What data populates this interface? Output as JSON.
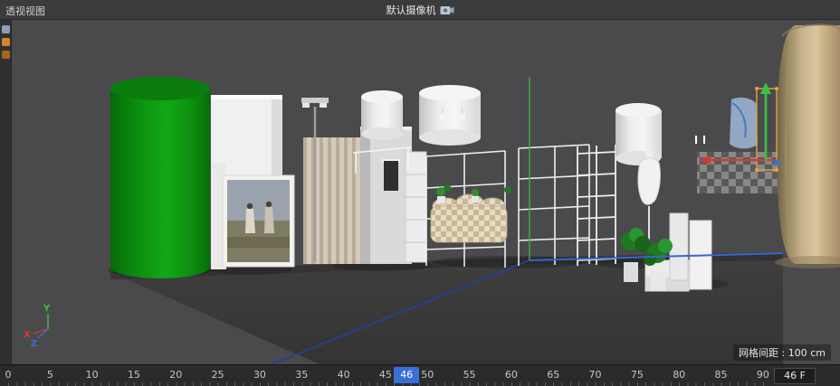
{
  "header": {
    "view_label": "透视视图",
    "camera_label": "默认摄像机"
  },
  "viewport": {
    "grid_info": "网格间距 : 100 cm",
    "axis_triad": {
      "x": "X",
      "y": "Y",
      "z": "Z"
    }
  },
  "left_toolbar": {
    "icons": [
      "view-tool-icon",
      "material-orange-icon-1",
      "material-orange-icon-2"
    ]
  },
  "timeline": {
    "ticks": [
      0,
      5,
      10,
      15,
      20,
      25,
      30,
      35,
      40,
      45,
      50,
      55,
      60,
      65,
      70,
      75,
      80,
      85,
      90
    ],
    "current_frame": "46",
    "frame_display": "46 F"
  },
  "colors": {
    "green_cylinder": "#0e9212",
    "curtain_beige": "#c9b48c",
    "axis_x_red": "#d23c30",
    "axis_y_green": "#3fbf3f",
    "axis_z_blue": "#3a6fd8",
    "selection_orange": "#e8a33d",
    "frame_marker_blue": "#3a6fd8"
  }
}
